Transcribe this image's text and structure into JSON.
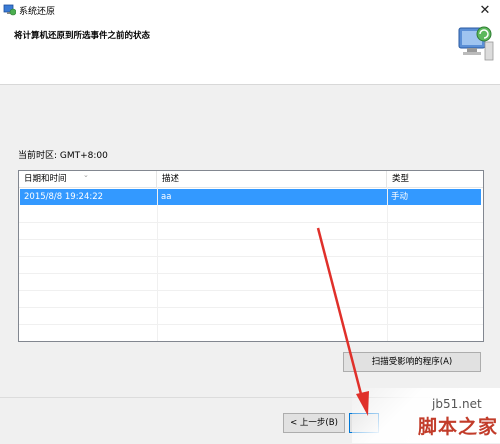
{
  "window": {
    "title": "系统还原"
  },
  "header": {
    "description": "将计算机还原到所选事件之前的状态"
  },
  "timezone_label": "当前时区: GMT+8:00",
  "table": {
    "columns": [
      "日期和时间",
      "描述",
      "类型"
    ],
    "rows": [
      {
        "datetime": "2015/8/8 19:24:22",
        "description": "aa",
        "type": "手动"
      }
    ]
  },
  "buttons": {
    "scan": "扫描受影响的程序(A)",
    "back": "< 上一步(B)"
  },
  "watermark": {
    "site": "jb51.net",
    "name": "脚本之家"
  },
  "colors": {
    "selection": "#3399ff",
    "annotation_arrow": "#e0302a"
  }
}
